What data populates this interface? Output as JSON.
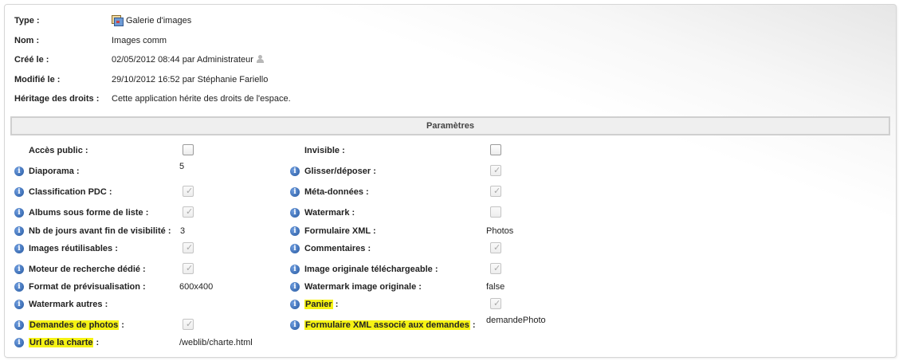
{
  "info": {
    "type_label": "Type :",
    "type_value": "Galerie d'images",
    "type_icon": "gallery-icon",
    "name_label": "Nom :",
    "name_value": "Images comm",
    "created_label": "Créé le :",
    "created_value": "02/05/2012 08:44 par Administrateur",
    "created_icon": "user-icon",
    "modified_label": "Modifié le :",
    "modified_value": "29/10/2012 16:52 par Stéphanie Fariello",
    "rights_label": "Héritage des droits :",
    "rights_value": "Cette application hérite des droits de l'espace."
  },
  "parameters": {
    "title": "Paramètres",
    "highlight_color": "#f5f214",
    "info_icon_color": "#24579f",
    "left": [
      {
        "label": "Accès public",
        "type": "checkbox",
        "checked": false,
        "disabled": false,
        "info": false,
        "highlight": false
      },
      {
        "label": "Diaporama",
        "type": "text",
        "value": "5",
        "info": true,
        "highlight": false
      },
      {
        "label": "Classification PDC",
        "type": "checkbox",
        "checked": true,
        "disabled": true,
        "info": true,
        "highlight": false
      },
      {
        "label": "Albums sous forme de liste",
        "type": "checkbox",
        "checked": true,
        "disabled": true,
        "info": true,
        "highlight": false
      },
      {
        "label": "Nb de jours avant fin de visibilité",
        "type": "text",
        "value": "3",
        "info": true,
        "highlight": false
      },
      {
        "label": "Images réutilisables",
        "type": "checkbox",
        "checked": true,
        "disabled": true,
        "info": true,
        "highlight": false
      },
      {
        "label": "Moteur de recherche dédié",
        "type": "checkbox",
        "checked": true,
        "disabled": true,
        "info": true,
        "highlight": false
      },
      {
        "label": "Format de prévisualisation",
        "type": "text",
        "value": "600x400",
        "info": true,
        "highlight": false
      },
      {
        "label": "Watermark autres",
        "type": "text",
        "value": "",
        "info": true,
        "highlight": false
      },
      {
        "label": "Demandes de photos",
        "type": "checkbox",
        "checked": true,
        "disabled": true,
        "info": true,
        "highlight": true
      },
      {
        "label": "Url de la charte",
        "type": "text",
        "value": "/weblib/charte.html",
        "info": true,
        "highlight": true
      }
    ],
    "right": [
      {
        "label": "Invisible",
        "type": "checkbox",
        "checked": false,
        "disabled": false,
        "info": false,
        "highlight": false
      },
      {
        "label": "Glisser/déposer",
        "type": "checkbox",
        "checked": true,
        "disabled": true,
        "info": true,
        "highlight": false
      },
      {
        "label": "Méta-données",
        "type": "checkbox",
        "checked": true,
        "disabled": true,
        "info": true,
        "highlight": false
      },
      {
        "label": "Watermark",
        "type": "checkbox",
        "checked": false,
        "disabled": true,
        "info": true,
        "highlight": false
      },
      {
        "label": "Formulaire XML",
        "type": "text",
        "value": "Photos",
        "info": true,
        "highlight": false
      },
      {
        "label": "Commentaires",
        "type": "checkbox",
        "checked": true,
        "disabled": true,
        "info": true,
        "highlight": false
      },
      {
        "label": "Image originale téléchargeable",
        "type": "checkbox",
        "checked": true,
        "disabled": true,
        "info": true,
        "highlight": false
      },
      {
        "label": "Watermark image originale",
        "type": "text",
        "value": "false",
        "info": true,
        "highlight": false
      },
      {
        "label": "Panier",
        "type": "checkbox",
        "checked": true,
        "disabled": true,
        "info": true,
        "highlight": true
      },
      {
        "label": "Formulaire XML associé aux demandes",
        "type": "text",
        "value": "demandePhoto",
        "info": true,
        "highlight": true
      },
      null
    ]
  }
}
